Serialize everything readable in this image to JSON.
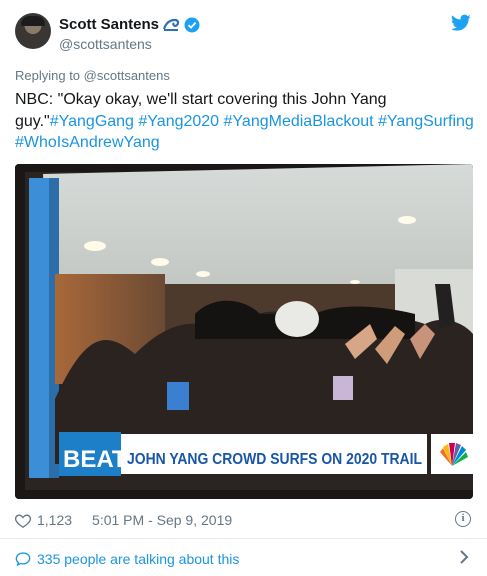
{
  "author": {
    "name": "Scott Santens",
    "handle": "@scottsantens",
    "avatar_icon": "profile-photo"
  },
  "reply": {
    "prefix": "Replying to",
    "handle": "@scottsantens"
  },
  "tweet": {
    "text_plain": "NBC: \"Okay okay, we'll start covering this John Yang guy.\"",
    "hashtags": [
      "#YangGang",
      "#Yang2020",
      "#YangMediaBlackout",
      "#YangSurfing",
      "#WhoIsAndrewYang"
    ]
  },
  "media": {
    "banner_show": "BEAT",
    "banner_headline": "JOHN YANG CROWD SURFS ON 2020 TRAIL",
    "network_icon": "nbc-peacock-icon"
  },
  "footer": {
    "likes": "1,123",
    "timestamp": "5:01 PM - Sep 9, 2019",
    "talking": "335 people are talking about this"
  },
  "colors": {
    "link": "#1b95e0",
    "muted": "#657786",
    "text": "#14171a"
  }
}
